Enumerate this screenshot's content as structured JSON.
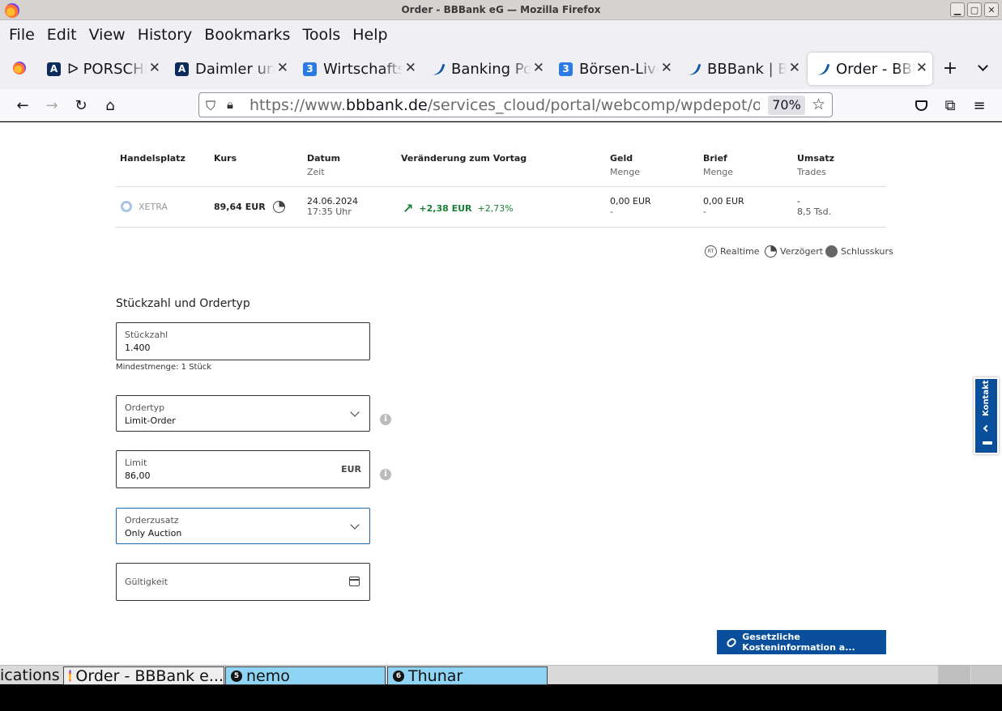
{
  "window": {
    "title": "Order - BBBank eG — Mozilla Firefox"
  },
  "menu": [
    "File",
    "Edit",
    "View",
    "History",
    "Bookmarks",
    "Tools",
    "Help"
  ],
  "tabs": [
    {
      "label": "ᐅ PORSCHE",
      "icon": "a-logo-icon"
    },
    {
      "label": "Daimler und",
      "icon": "a-logo-icon"
    },
    {
      "label": "Wirtschafts",
      "icon": "3-logo-icon"
    },
    {
      "label": "Banking Po",
      "icon": "bbbank-swoosh-icon"
    },
    {
      "label": "Börsen-Live",
      "icon": "3-logo-icon"
    },
    {
      "label": "BBBank | B",
      "icon": "bbbank-swoosh-icon"
    },
    {
      "label": "Order - BBE",
      "icon": "bbbank-swoosh-icon",
      "active": true
    }
  ],
  "nav": {
    "url_prefix": "https://www.",
    "url_domain": "bbbank.de",
    "url_path": "/services_cloud/portal/webcomp/wpdepot/or",
    "zoom": "70%"
  },
  "quote_table": {
    "headers": [
      {
        "label": "Handelsplatz",
        "sub": ""
      },
      {
        "label": "Kurs",
        "sub": ""
      },
      {
        "label": "Datum",
        "sub": "Zeit"
      },
      {
        "label": "Veränderung zum Vortag",
        "sub": ""
      },
      {
        "label": "Geld",
        "sub": "Menge"
      },
      {
        "label": "Brief",
        "sub": "Menge"
      },
      {
        "label": "Umsatz",
        "sub": "Trades"
      }
    ],
    "row": {
      "venue": "XETRA",
      "price": "89,64",
      "currency": "EUR",
      "date": "24.06.2024",
      "time": "17:35   Uhr",
      "change_abs": "+2,38 EUR",
      "change_pct": "+2,73%",
      "bid": "0,00 EUR",
      "bid_qty": "-",
      "ask": "0,00 EUR",
      "ask_qty": "-",
      "turnover": "-",
      "trades": "8,5 Tsd."
    }
  },
  "legend": {
    "realtime": "Realtime",
    "delayed": "Verzögert",
    "close": "Schlusskurs",
    "rt_badge": "RT"
  },
  "order": {
    "section_title": "Stückzahl und Ordertyp",
    "quantity_label": "Stückzahl",
    "quantity_value": "1.400",
    "min_hint": "Mindestmenge: 1 Stück",
    "ordertype_label": "Ordertyp",
    "ordertype_value": "Limit-Order",
    "limit_label": "Limit",
    "limit_value": "86,00",
    "limit_currency": "EUR",
    "addition_label": "Orderzusatz",
    "addition_value": "Only Auction",
    "validity_label": "Gültigkeit"
  },
  "cost_button": "Gesetzliche Kosteninformation a...",
  "kontakt": "Kontakt",
  "taskbar": {
    "left_text": "ications",
    "items": [
      {
        "label": "Order - BBBank e...",
        "badge": ""
      },
      {
        "label": "nemo",
        "badge": "5"
      },
      {
        "label": "Thunar",
        "badge": "6"
      }
    ]
  }
}
